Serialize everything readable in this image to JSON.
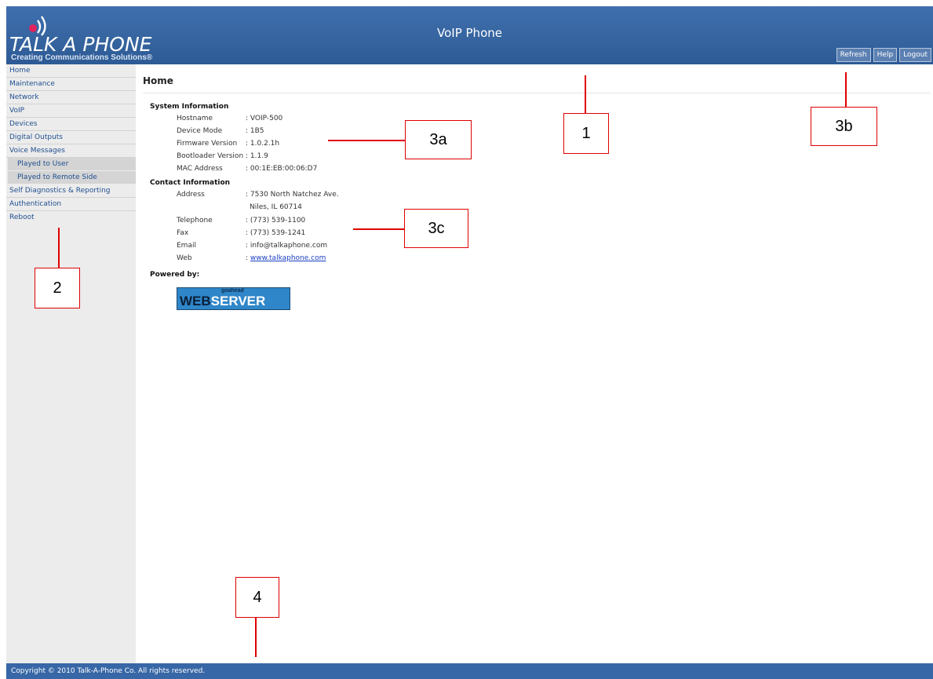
{
  "header": {
    "logo_text": "TALK A PHONE",
    "logo_tagline": "Creating Communications Solutions®",
    "title": "VoIP Phone",
    "buttons": [
      "Refresh",
      "Help",
      "Logout"
    ]
  },
  "sidebar": {
    "items": [
      {
        "label": "Home"
      },
      {
        "label": "Maintenance"
      },
      {
        "label": "Network"
      },
      {
        "label": "VoIP"
      },
      {
        "label": "Devices"
      },
      {
        "label": "Digital Outputs"
      },
      {
        "label": "Voice Messages"
      }
    ],
    "sub_items": [
      {
        "label": "Played to User"
      },
      {
        "label": "Played to Remote Side"
      }
    ],
    "items_after": [
      {
        "label": "Self Diagnostics & Reporting"
      },
      {
        "label": "Authentication"
      },
      {
        "label": "Reboot"
      }
    ]
  },
  "main": {
    "page_title": "Home",
    "system_info": {
      "heading": "System Information",
      "rows": [
        {
          "label": "Hostname",
          "value": ": VOIP-500"
        },
        {
          "label": "Device Mode",
          "value": ": 1B5"
        },
        {
          "label": "Firmware Version",
          "value": ": 1.0.2.1h"
        },
        {
          "label": "Bootloader Version",
          "value": ": 1.1.9"
        },
        {
          "label": "MAC Address",
          "value": ": 00:1E:EB:00:06:D7"
        }
      ]
    },
    "contact_info": {
      "heading": "Contact Information",
      "rows": [
        {
          "label": "Address",
          "value": ": 7530 North Natchez Ave."
        },
        {
          "label": "",
          "value": "Niles, IL 60714"
        },
        {
          "label": "Telephone",
          "value": ": (773) 539-1100"
        },
        {
          "label": "Fax",
          "value": ": (773) 539-1241"
        },
        {
          "label": "Email",
          "value": ": info@talkaphone.com"
        },
        {
          "label": "Web",
          "value_prefix": ": ",
          "link": "www.talkaphone.com"
        }
      ]
    },
    "powered_by": {
      "heading": "Powered by:",
      "logo_small": "goahead",
      "logo_web": "WEB",
      "logo_server": "SERVER"
    }
  },
  "footer": {
    "copyright": "Copyright © 2010 Talk-A-Phone Co. All rights reserved."
  },
  "callouts": [
    "1",
    "2",
    "3a",
    "3b",
    "3c",
    "4"
  ],
  "colors": {
    "header_bg": "#35649f",
    "sidebar_bg": "#ececec",
    "sidebar_sub_bg": "#d4d4d4",
    "nav_link": "#1f4f8f",
    "callout_red": "#e00000"
  }
}
